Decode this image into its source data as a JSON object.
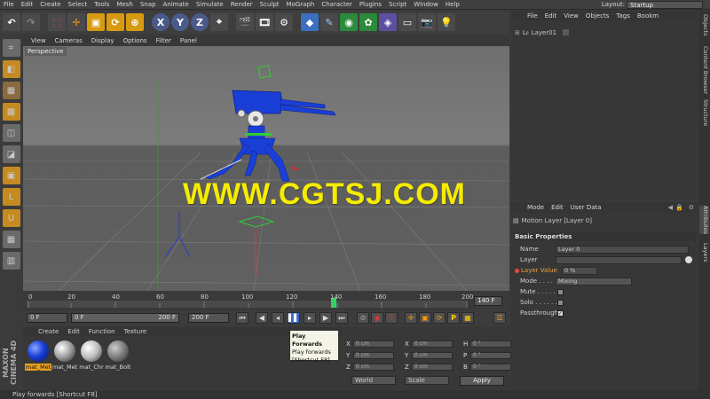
{
  "menubar": {
    "items": [
      "File",
      "Edit",
      "Create",
      "Select",
      "Tools",
      "Mesh",
      "Snap",
      "Animate",
      "Simulate",
      "Render",
      "Sculpt",
      "MoGraph",
      "Character",
      "Plugins",
      "Script",
      "Window",
      "Help"
    ],
    "layout_label": "Layout:",
    "layout_value": "Startup"
  },
  "viewport": {
    "menu": [
      "View",
      "Cameras",
      "Display",
      "Options",
      "Filter",
      "Panel"
    ],
    "label": "Perspective",
    "watermark": "WWW.CGTSJ.COM"
  },
  "timeline": {
    "ticks": [
      "0",
      "20",
      "40",
      "60",
      "80",
      "100",
      "120",
      "140",
      "160",
      "180",
      "200"
    ],
    "current_frame": "140 F"
  },
  "transport": {
    "start": "0 F",
    "range_start": "0 F",
    "range_end": "200 F",
    "end": "200 F"
  },
  "tooltip": {
    "title": "Play Forwards",
    "desc": "Play forwards",
    "shortcut": "[Shortcut F8]"
  },
  "materials": {
    "menu": [
      "Create",
      "Edit",
      "Function",
      "Texture"
    ],
    "items": [
      {
        "label": "mat_Met",
        "color": "#1a3fd6"
      },
      {
        "label": "mat_Met",
        "color": "#e0e0e0"
      },
      {
        "label": "mat_Chr",
        "color": "#f2f2f2"
      },
      {
        "label": "mat_Bolt",
        "color": "#8a8a8a"
      }
    ]
  },
  "coords": {
    "rows": [
      {
        "a": "X",
        "av": "0 cm",
        "b": "X",
        "bv": "0 cm",
        "c": "H",
        "cv": "0 °"
      },
      {
        "a": "Y",
        "av": "0 cm",
        "b": "Y",
        "bv": "0 cm",
        "c": "P",
        "cv": "0 °"
      },
      {
        "a": "Z",
        "av": "0 cm",
        "b": "Z",
        "bv": "0 cm",
        "c": "B",
        "cv": "0 °"
      }
    ],
    "world": "World",
    "scale": "Scale",
    "apply": "Apply"
  },
  "objects": {
    "menu": [
      "File",
      "Edit",
      "View",
      "Objects",
      "Tags",
      "Bookm"
    ],
    "item": "Layer01"
  },
  "attributes": {
    "menu": [
      "Mode",
      "Edit",
      "User Data"
    ],
    "title": "Motion Layer [Layer 0]",
    "section": "Basic Properties",
    "name_label": "Name",
    "name_value": "Layer 0",
    "layer_label": "Layer",
    "layer_value_label": "Layer Value",
    "layer_value": "0 %",
    "mode_label": "Mode . . . . . .",
    "mode_value": "Mixing",
    "mute_label": "Mute . . . . . .",
    "solo_label": "Solo . . . . . .",
    "pass_label": "Passthrough",
    "pass_check": "✓"
  },
  "right_tabs": [
    "Objects",
    "Content Browser",
    "Structure",
    "Attributes",
    "Layers"
  ],
  "brand": "MAXON CINEMA 4D",
  "status": "Play forwards [Shortcut F8]",
  "colors": {
    "accent": "#f5ec00",
    "robot": "#1a3fd6",
    "play": "#ffffff"
  }
}
